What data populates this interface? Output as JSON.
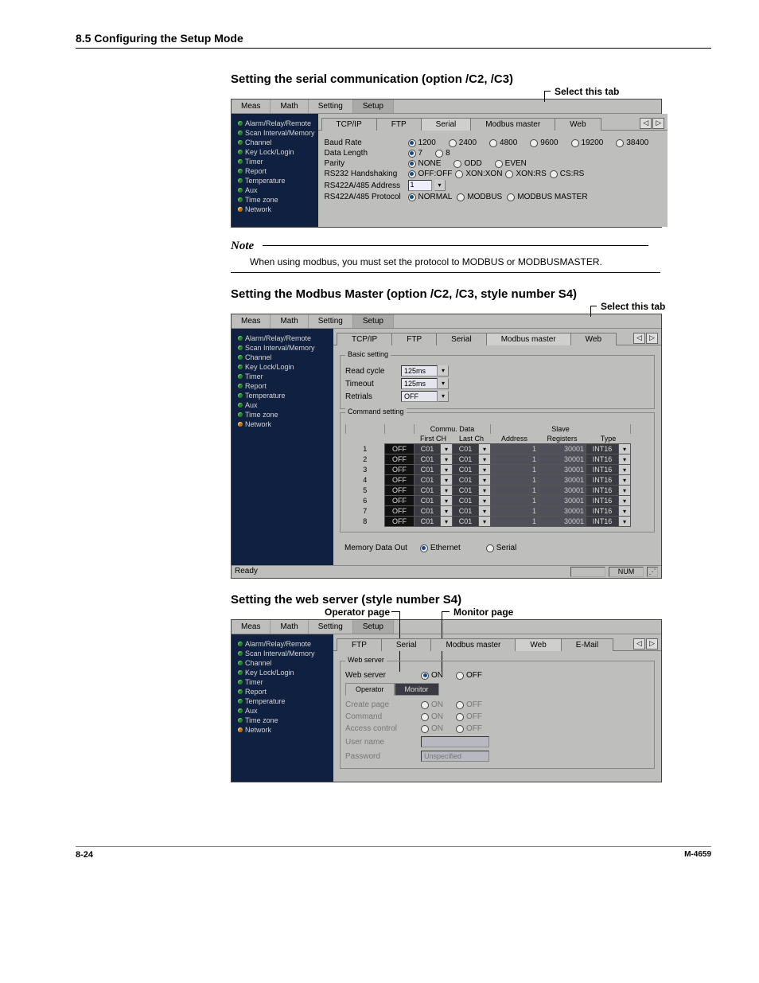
{
  "header": "8.5  Configuring the Setup Mode",
  "section1": {
    "title": "Setting the serial communication (option /C2, /C3)",
    "annotation": "Select this tab"
  },
  "menubar": {
    "meas": "Meas",
    "math": "Math",
    "setting": "Setting",
    "setup": "Setup"
  },
  "sidebar": {
    "items": [
      {
        "label": "Alarm/Relay/Remote",
        "color": "green"
      },
      {
        "label": "Scan Interval/Memory",
        "color": "green"
      },
      {
        "label": "Channel",
        "color": "green"
      },
      {
        "label": "Key Lock/Login",
        "color": "green"
      },
      {
        "label": "Timer",
        "color": "green"
      },
      {
        "label": "Report",
        "color": "green"
      },
      {
        "label": "Temperature",
        "color": "green"
      },
      {
        "label": "Aux",
        "color": "green"
      },
      {
        "label": "Time zone",
        "color": "green"
      },
      {
        "label": "Network",
        "color": "orange"
      }
    ]
  },
  "tabs": {
    "tcp": "TCP/IP",
    "ftp": "FTP",
    "serial": "Serial",
    "modbus": "Modbus master",
    "web": "Web",
    "email": "E-Mail"
  },
  "serial_form": {
    "baud": {
      "label": "Baud Rate",
      "opts": [
        "1200",
        "2400",
        "4800",
        "9600",
        "19200",
        "38400"
      ],
      "sel": 0
    },
    "datalen": {
      "label": "Data Length",
      "opts": [
        "7",
        "8"
      ],
      "sel": 0
    },
    "parity": {
      "label": "Parity",
      "opts": [
        "NONE",
        "ODD",
        "EVEN"
      ],
      "sel": 0
    },
    "hs": {
      "label": "RS232 Handshaking",
      "opts": [
        "OFF:OFF",
        "XON:XON",
        "XON:RS",
        "CS:RS"
      ],
      "sel": 0
    },
    "addr": {
      "label": "RS422A/485 Address",
      "value": "1"
    },
    "proto": {
      "label": "RS422A/485 Protocol",
      "opts": [
        "NORMAL",
        "MODBUS",
        "MODBUS MASTER"
      ],
      "sel": 0
    }
  },
  "note": {
    "title": "Note",
    "text": "When using modbus, you must set the protocol to MODBUS or MODBUSMASTER."
  },
  "section2": {
    "title": "Setting the Modbus Master (option /C2, /C3, style number S4)",
    "annotation": "Select this tab"
  },
  "modbus_panel": {
    "basic_legend": "Basic setting",
    "read_cycle": {
      "label": "Read cycle",
      "value": "125ms"
    },
    "timeout": {
      "label": "Timeout",
      "value": "125ms"
    },
    "retrials": {
      "label": "Retrials",
      "value": "OFF"
    },
    "command_legend": "Command setting",
    "head": {
      "commu": "Commu. Data",
      "slave": "Slave",
      "first": "First CH",
      "last": "Last Ch",
      "addr": "Address",
      "reg": "Registers",
      "type": "Type"
    },
    "rows": [
      {
        "idx": "1",
        "onoff": "OFF",
        "fch": "C01",
        "lch": "C01",
        "addr": "1",
        "reg": "30001",
        "type": "INT16"
      },
      {
        "idx": "2",
        "onoff": "OFF",
        "fch": "C01",
        "lch": "C01",
        "addr": "1",
        "reg": "30001",
        "type": "INT16"
      },
      {
        "idx": "3",
        "onoff": "OFF",
        "fch": "C01",
        "lch": "C01",
        "addr": "1",
        "reg": "30001",
        "type": "INT16"
      },
      {
        "idx": "4",
        "onoff": "OFF",
        "fch": "C01",
        "lch": "C01",
        "addr": "1",
        "reg": "30001",
        "type": "INT16"
      },
      {
        "idx": "5",
        "onoff": "OFF",
        "fch": "C01",
        "lch": "C01",
        "addr": "1",
        "reg": "30001",
        "type": "INT16"
      },
      {
        "idx": "6",
        "onoff": "OFF",
        "fch": "C01",
        "lch": "C01",
        "addr": "1",
        "reg": "30001",
        "type": "INT16"
      },
      {
        "idx": "7",
        "onoff": "OFF",
        "fch": "C01",
        "lch": "C01",
        "addr": "1",
        "reg": "30001",
        "type": "INT16"
      },
      {
        "idx": "8",
        "onoff": "OFF",
        "fch": "C01",
        "lch": "C01",
        "addr": "1",
        "reg": "30001",
        "type": "INT16"
      }
    ],
    "memout": {
      "label": "Memory Data Out",
      "opts": [
        "Ethernet",
        "Serial"
      ],
      "sel": 0
    },
    "status": {
      "ready": "Ready",
      "num": "NUM"
    }
  },
  "section3": {
    "title": "Setting the web server (style number S4)",
    "ann_operator": "Operator page",
    "ann_monitor": "Monitor page"
  },
  "web_panel": {
    "group_legend": "Web server",
    "web_server": {
      "label": "Web server",
      "opts": [
        "ON",
        "OFF"
      ],
      "sel": 0
    },
    "sub_tabs": {
      "op": "Operator",
      "mon": "Monitor"
    },
    "create": {
      "label": "Create page",
      "opts": [
        "ON",
        "OFF"
      ],
      "sel": 0
    },
    "command": {
      "label": "Command",
      "opts": [
        "ON",
        "OFF"
      ],
      "sel": 0
    },
    "access": {
      "label": "Access control",
      "opts": [
        "ON",
        "OFF"
      ],
      "sel": 0
    },
    "user": {
      "label": "User name",
      "value": ""
    },
    "pass": {
      "label": "Password",
      "value": "Unspecified"
    }
  },
  "footer": {
    "page": "8-24",
    "doc": "M-4659"
  }
}
